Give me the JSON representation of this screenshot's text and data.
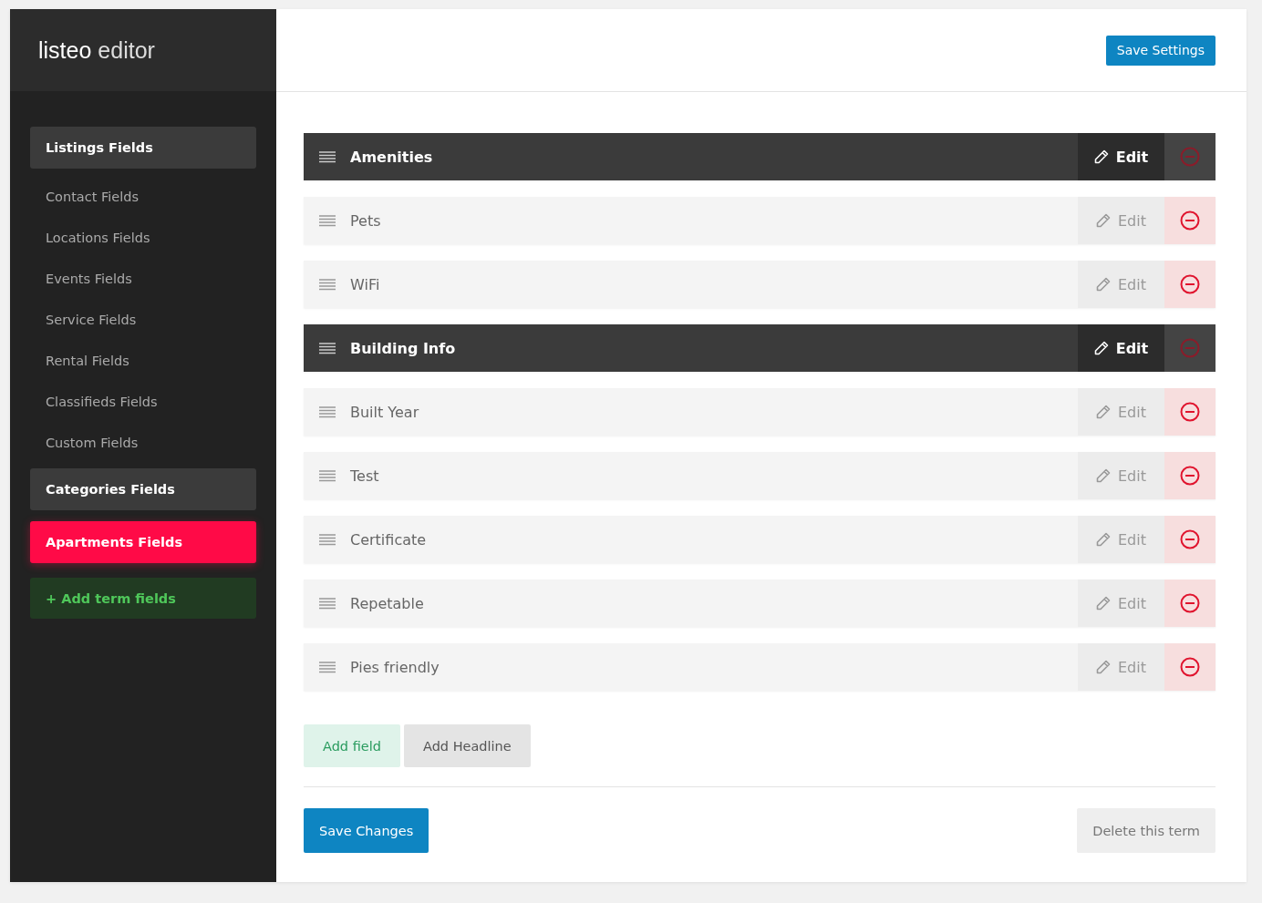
{
  "logo": {
    "brand": "listeo",
    "suffix": "editor"
  },
  "sidebar": {
    "items": [
      {
        "label": "Listings Fields",
        "kind": "section",
        "selected": false
      },
      {
        "label": "Contact Fields",
        "kind": "link",
        "selected": false
      },
      {
        "label": "Locations Fields",
        "kind": "link",
        "selected": false
      },
      {
        "label": "Events Fields",
        "kind": "link",
        "selected": false
      },
      {
        "label": "Service Fields",
        "kind": "link",
        "selected": false
      },
      {
        "label": "Rental Fields",
        "kind": "link",
        "selected": false
      },
      {
        "label": "Classifieds Fields",
        "kind": "link",
        "selected": false
      },
      {
        "label": "Custom Fields",
        "kind": "link",
        "selected": false
      },
      {
        "label": "Categories Fields",
        "kind": "section",
        "selected": false
      },
      {
        "label": "Apartments Fields",
        "kind": "section",
        "selected": true
      },
      {
        "label": "+ Add term fields",
        "kind": "add",
        "selected": false
      }
    ]
  },
  "header": {
    "save_button": "Save Settings"
  },
  "fields": [
    {
      "label": "Amenities",
      "kind": "headline",
      "edit": "Edit"
    },
    {
      "label": "Pets",
      "kind": "field",
      "edit": "Edit"
    },
    {
      "label": "WiFi",
      "kind": "field",
      "edit": "Edit"
    },
    {
      "label": "Building Info",
      "kind": "headline",
      "edit": "Edit"
    },
    {
      "label": "Built Year",
      "kind": "field",
      "edit": "Edit"
    },
    {
      "label": "Test",
      "kind": "field",
      "edit": "Edit"
    },
    {
      "label": "Certificate",
      "kind": "field",
      "edit": "Edit"
    },
    {
      "label": "Repetable",
      "kind": "field",
      "edit": "Edit"
    },
    {
      "label": "Pies friendly",
      "kind": "field",
      "edit": "Edit"
    }
  ],
  "add_buttons": [
    {
      "label": "Add field",
      "kind": "field"
    },
    {
      "label": "Add Headline",
      "kind": "headline"
    }
  ],
  "footer": {
    "save_button": "Save Changes",
    "delete_button": "Delete this term"
  }
}
